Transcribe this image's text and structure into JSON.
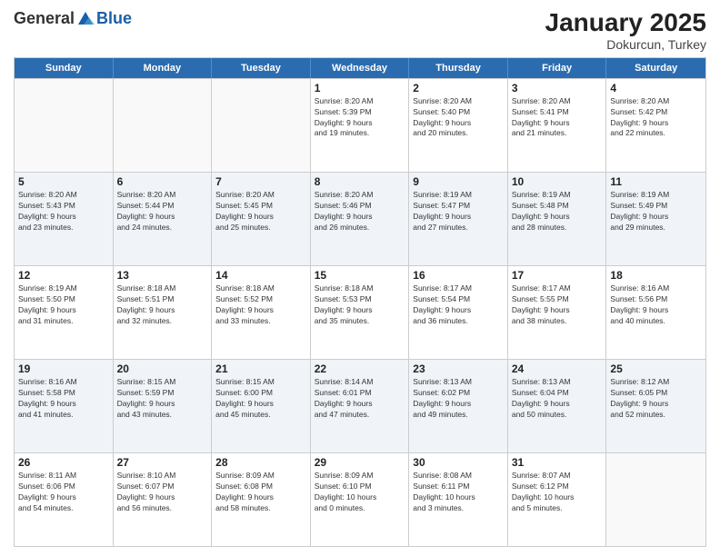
{
  "logo": {
    "general": "General",
    "blue": "Blue"
  },
  "title": "January 2025",
  "subtitle": "Dokurcun, Turkey",
  "days": [
    "Sunday",
    "Monday",
    "Tuesday",
    "Wednesday",
    "Thursday",
    "Friday",
    "Saturday"
  ],
  "weeks": [
    [
      {
        "day": "",
        "info": ""
      },
      {
        "day": "",
        "info": ""
      },
      {
        "day": "",
        "info": ""
      },
      {
        "day": "1",
        "info": "Sunrise: 8:20 AM\nSunset: 5:39 PM\nDaylight: 9 hours\nand 19 minutes."
      },
      {
        "day": "2",
        "info": "Sunrise: 8:20 AM\nSunset: 5:40 PM\nDaylight: 9 hours\nand 20 minutes."
      },
      {
        "day": "3",
        "info": "Sunrise: 8:20 AM\nSunset: 5:41 PM\nDaylight: 9 hours\nand 21 minutes."
      },
      {
        "day": "4",
        "info": "Sunrise: 8:20 AM\nSunset: 5:42 PM\nDaylight: 9 hours\nand 22 minutes."
      }
    ],
    [
      {
        "day": "5",
        "info": "Sunrise: 8:20 AM\nSunset: 5:43 PM\nDaylight: 9 hours\nand 23 minutes."
      },
      {
        "day": "6",
        "info": "Sunrise: 8:20 AM\nSunset: 5:44 PM\nDaylight: 9 hours\nand 24 minutes."
      },
      {
        "day": "7",
        "info": "Sunrise: 8:20 AM\nSunset: 5:45 PM\nDaylight: 9 hours\nand 25 minutes."
      },
      {
        "day": "8",
        "info": "Sunrise: 8:20 AM\nSunset: 5:46 PM\nDaylight: 9 hours\nand 26 minutes."
      },
      {
        "day": "9",
        "info": "Sunrise: 8:19 AM\nSunset: 5:47 PM\nDaylight: 9 hours\nand 27 minutes."
      },
      {
        "day": "10",
        "info": "Sunrise: 8:19 AM\nSunset: 5:48 PM\nDaylight: 9 hours\nand 28 minutes."
      },
      {
        "day": "11",
        "info": "Sunrise: 8:19 AM\nSunset: 5:49 PM\nDaylight: 9 hours\nand 29 minutes."
      }
    ],
    [
      {
        "day": "12",
        "info": "Sunrise: 8:19 AM\nSunset: 5:50 PM\nDaylight: 9 hours\nand 31 minutes."
      },
      {
        "day": "13",
        "info": "Sunrise: 8:18 AM\nSunset: 5:51 PM\nDaylight: 9 hours\nand 32 minutes."
      },
      {
        "day": "14",
        "info": "Sunrise: 8:18 AM\nSunset: 5:52 PM\nDaylight: 9 hours\nand 33 minutes."
      },
      {
        "day": "15",
        "info": "Sunrise: 8:18 AM\nSunset: 5:53 PM\nDaylight: 9 hours\nand 35 minutes."
      },
      {
        "day": "16",
        "info": "Sunrise: 8:17 AM\nSunset: 5:54 PM\nDaylight: 9 hours\nand 36 minutes."
      },
      {
        "day": "17",
        "info": "Sunrise: 8:17 AM\nSunset: 5:55 PM\nDaylight: 9 hours\nand 38 minutes."
      },
      {
        "day": "18",
        "info": "Sunrise: 8:16 AM\nSunset: 5:56 PM\nDaylight: 9 hours\nand 40 minutes."
      }
    ],
    [
      {
        "day": "19",
        "info": "Sunrise: 8:16 AM\nSunset: 5:58 PM\nDaylight: 9 hours\nand 41 minutes."
      },
      {
        "day": "20",
        "info": "Sunrise: 8:15 AM\nSunset: 5:59 PM\nDaylight: 9 hours\nand 43 minutes."
      },
      {
        "day": "21",
        "info": "Sunrise: 8:15 AM\nSunset: 6:00 PM\nDaylight: 9 hours\nand 45 minutes."
      },
      {
        "day": "22",
        "info": "Sunrise: 8:14 AM\nSunset: 6:01 PM\nDaylight: 9 hours\nand 47 minutes."
      },
      {
        "day": "23",
        "info": "Sunrise: 8:13 AM\nSunset: 6:02 PM\nDaylight: 9 hours\nand 49 minutes."
      },
      {
        "day": "24",
        "info": "Sunrise: 8:13 AM\nSunset: 6:04 PM\nDaylight: 9 hours\nand 50 minutes."
      },
      {
        "day": "25",
        "info": "Sunrise: 8:12 AM\nSunset: 6:05 PM\nDaylight: 9 hours\nand 52 minutes."
      }
    ],
    [
      {
        "day": "26",
        "info": "Sunrise: 8:11 AM\nSunset: 6:06 PM\nDaylight: 9 hours\nand 54 minutes."
      },
      {
        "day": "27",
        "info": "Sunrise: 8:10 AM\nSunset: 6:07 PM\nDaylight: 9 hours\nand 56 minutes."
      },
      {
        "day": "28",
        "info": "Sunrise: 8:09 AM\nSunset: 6:08 PM\nDaylight: 9 hours\nand 58 minutes."
      },
      {
        "day": "29",
        "info": "Sunrise: 8:09 AM\nSunset: 6:10 PM\nDaylight: 10 hours\nand 0 minutes."
      },
      {
        "day": "30",
        "info": "Sunrise: 8:08 AM\nSunset: 6:11 PM\nDaylight: 10 hours\nand 3 minutes."
      },
      {
        "day": "31",
        "info": "Sunrise: 8:07 AM\nSunset: 6:12 PM\nDaylight: 10 hours\nand 5 minutes."
      },
      {
        "day": "",
        "info": ""
      }
    ]
  ]
}
